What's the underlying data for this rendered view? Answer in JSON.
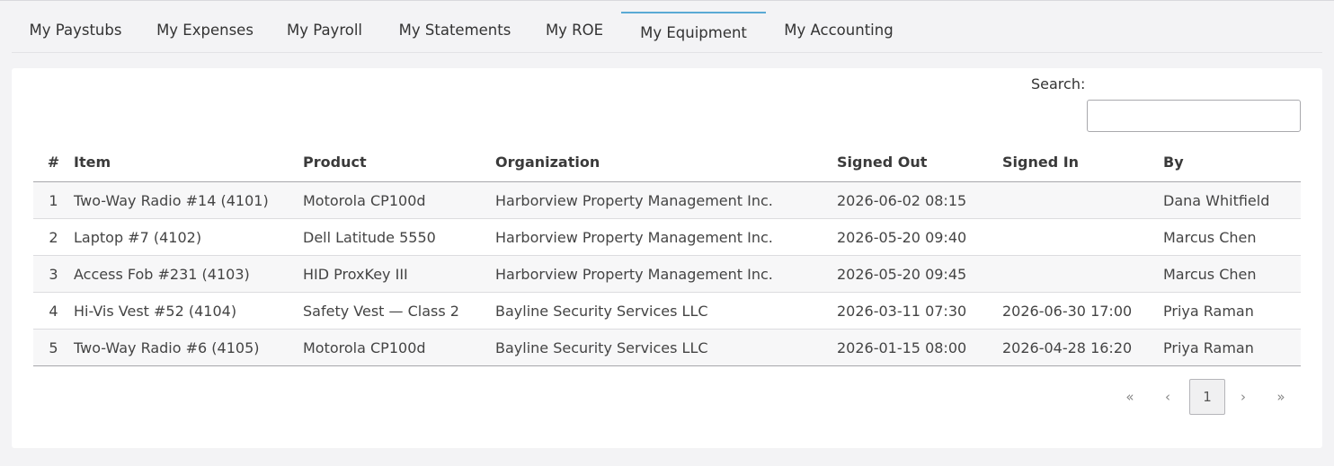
{
  "tabs": [
    {
      "label": "My Paystubs"
    },
    {
      "label": "My Expenses"
    },
    {
      "label": "My Payroll"
    },
    {
      "label": "My Statements"
    },
    {
      "label": "My ROE"
    },
    {
      "label": "My Equipment",
      "active": true
    },
    {
      "label": "My Accounting"
    }
  ],
  "search": {
    "label": "Search:",
    "value": "",
    "placeholder": ""
  },
  "table": {
    "headers": [
      "#",
      "Item",
      "Product",
      "Organization",
      "Signed Out",
      "Signed In",
      "By"
    ],
    "rows": [
      [
        "1",
        "Two-Way Radio #14 (4101)",
        "Motorola CP100d",
        "Harborview Property Management Inc.",
        "2026-06-02 08:15",
        "",
        "Dana Whitfield"
      ],
      [
        "2",
        "Laptop #7 (4102)",
        "Dell Latitude 5550",
        "Harborview Property Management Inc.",
        "2026-05-20 09:40",
        "",
        "Marcus Chen"
      ],
      [
        "3",
        "Access Fob #231 (4103)",
        "HID ProxKey III",
        "Harborview Property Management Inc.",
        "2026-05-20 09:45",
        "",
        "Marcus Chen"
      ],
      [
        "4",
        "Hi-Vis Vest #52 (4104)",
        "Safety Vest — Class 2",
        "Bayline Security Services LLC",
        "2026-03-11 07:30",
        "2026-06-30 17:00",
        "Priya Raman"
      ],
      [
        "5",
        "Two-Way Radio #6 (4105)",
        "Motorola CP100d",
        "Bayline Security Services LLC",
        "2026-01-15 08:00",
        "2026-04-28 16:20",
        "Priya Raman"
      ]
    ]
  },
  "pagination": {
    "first": "«",
    "prev": "‹",
    "current": "1",
    "next": "›",
    "last": "»"
  },
  "colors": {
    "active_tab_accent": "#5aa9d4",
    "page_background": "#f3f3f5"
  }
}
